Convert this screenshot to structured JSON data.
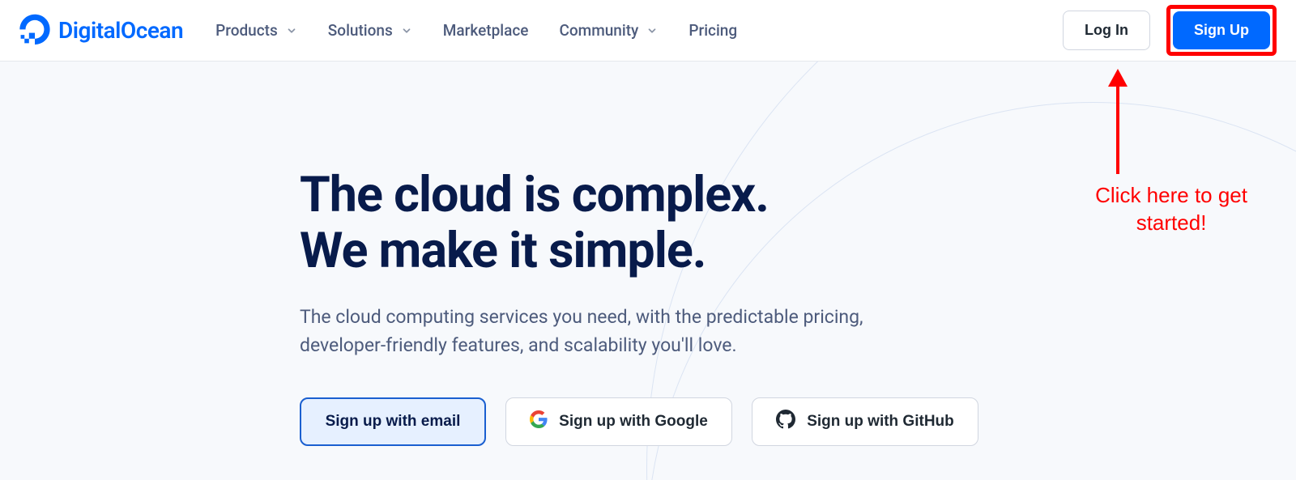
{
  "brand": {
    "name": "DigitalOcean"
  },
  "nav": {
    "items": [
      {
        "label": "Products",
        "hasDropdown": true
      },
      {
        "label": "Solutions",
        "hasDropdown": true
      },
      {
        "label": "Marketplace",
        "hasDropdown": false
      },
      {
        "label": "Community",
        "hasDropdown": true
      },
      {
        "label": "Pricing",
        "hasDropdown": false
      }
    ]
  },
  "header": {
    "login_label": "Log In",
    "signup_label": "Sign Up"
  },
  "hero": {
    "title_line1": "The cloud is complex.",
    "title_line2": "We make it simple.",
    "subtitle": "The cloud computing services you need, with the predictable pricing, developer-friendly features, and scalability you'll love.",
    "signup_email_label": "Sign up with email",
    "signup_google_label": "Sign up with Google",
    "signup_github_label": "Sign up with GitHub"
  },
  "annotation": {
    "text_line1": "Click here to get",
    "text_line2": "started!"
  },
  "colors": {
    "brand_blue": "#0069ff",
    "dark_navy": "#081b4b",
    "muted_text": "#4d5b7c",
    "annotation_red": "#ff0000",
    "hero_bg": "#f7f9fc"
  }
}
